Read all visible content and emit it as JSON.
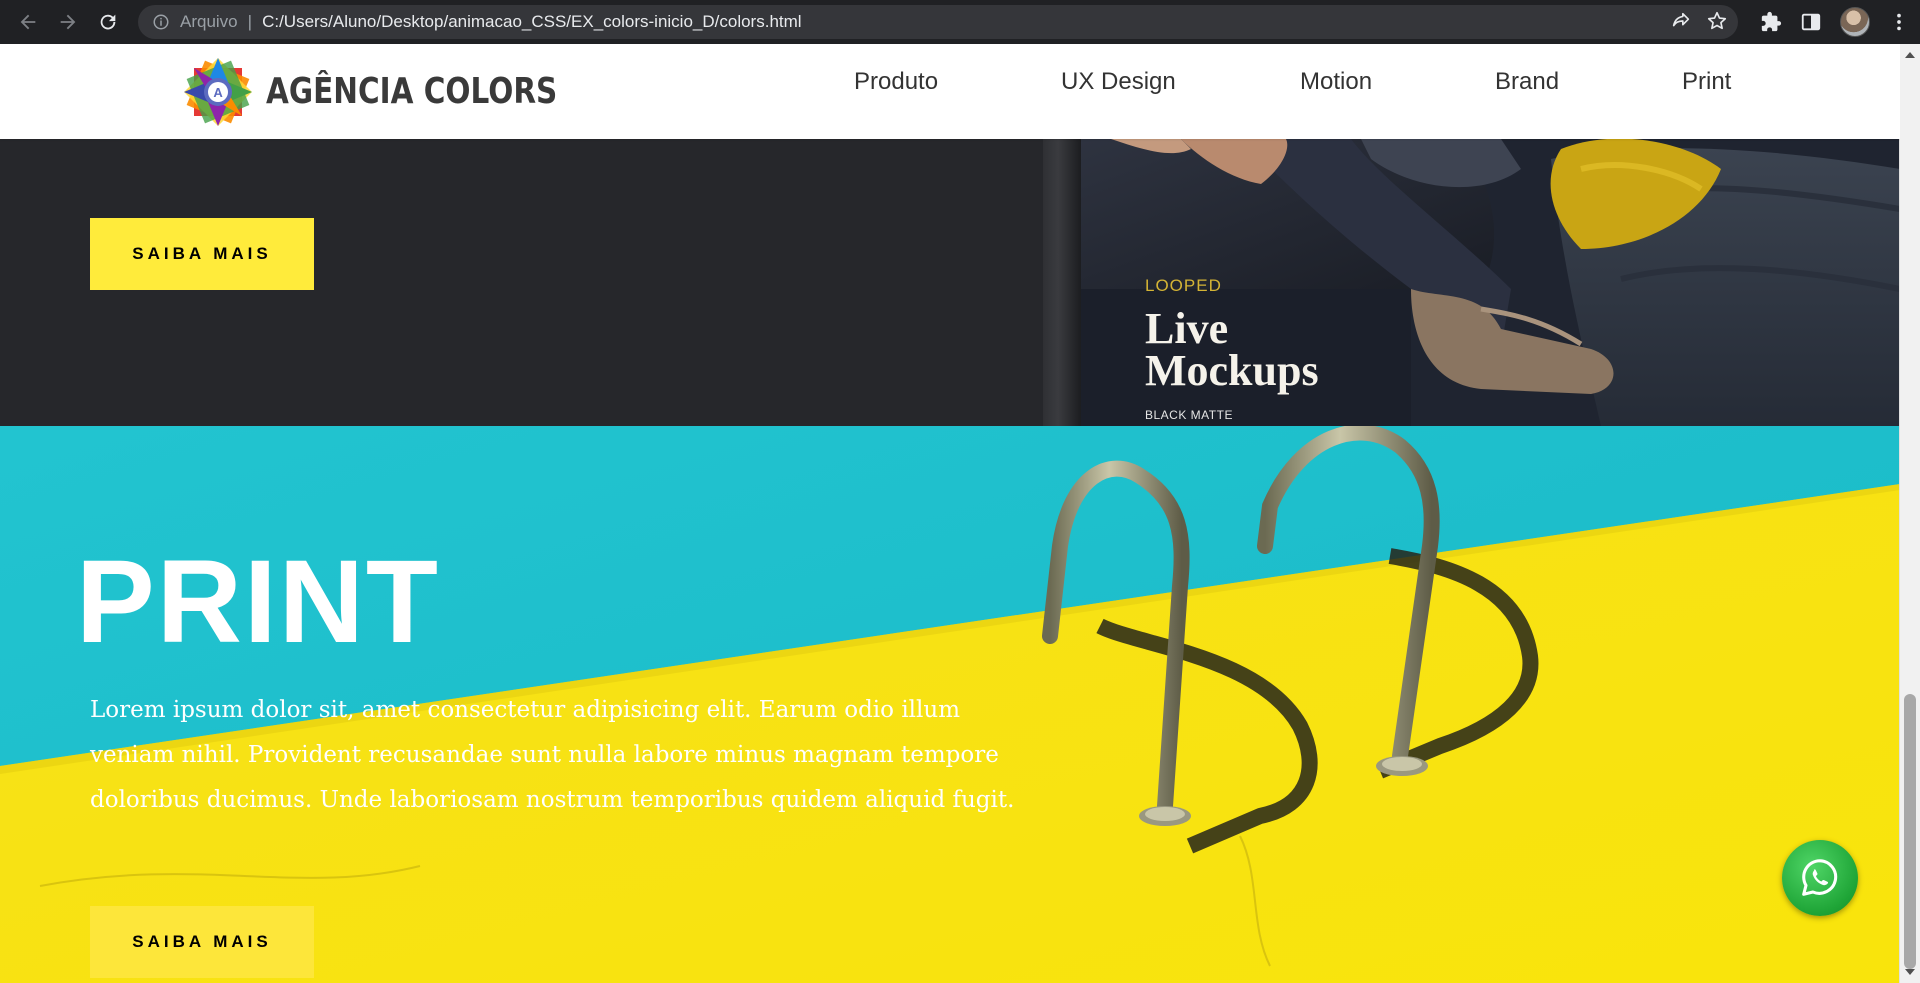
{
  "browser": {
    "security_label": "Arquivo",
    "separator": "|",
    "url": "C:/Users/Aluno/Desktop/animacao_CSS/EX_colors-inicio_D/colors.html"
  },
  "header": {
    "logo_text": "AGÊNCIA COLORS",
    "logo_letter": "A",
    "nav": [
      "Produto",
      "UX Design",
      "Motion",
      "Brand",
      "Print"
    ]
  },
  "dark_section": {
    "button_label": "SAIBA MAIS",
    "mockup": {
      "kicker": "LOOPED",
      "title_line1": "Live",
      "title_line2": "Mockups",
      "subtitle": "BLACK MATTE"
    }
  },
  "print_section": {
    "title": "PRINT",
    "text": "Lorem ipsum dolor sit, amet consectetur adipisicing elit. Earum odio illum veniam nihil. Provident recusandae sunt nulla labore minus magnam tempore doloribus ducimus. Unde laboriosam nostrum temporibus quidem aliquid fugit.",
    "button_label": "SAIBA MAIS"
  },
  "colors": {
    "accent_yellow": "#ffeb3b",
    "pool_cyan": "#1ec3cf",
    "dark_bg": "#26272b",
    "whatsapp_green": "#25d366"
  },
  "icons": [
    "back-arrow-icon",
    "forward-arrow-icon",
    "reload-icon",
    "info-icon",
    "share-icon",
    "star-icon",
    "extensions-icon",
    "sidebar-icon",
    "menu-dots-icon",
    "whatsapp-icon"
  ]
}
